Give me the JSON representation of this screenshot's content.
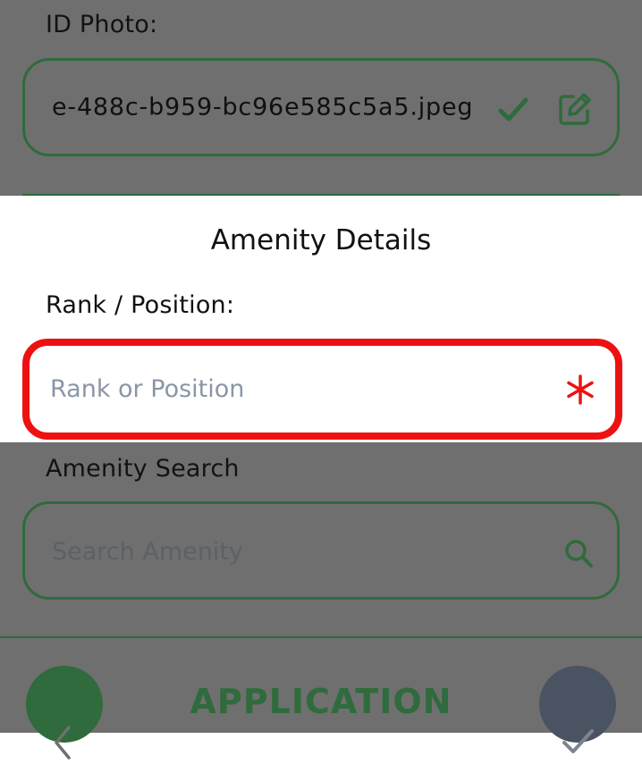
{
  "id_photo": {
    "label": "ID Photo:",
    "value": "e-488c-b959-bc96e585c5a5.jpeg"
  },
  "amenity_details": {
    "title": "Amenity Details"
  },
  "rank_position": {
    "label": "Rank / Position:",
    "placeholder": "Rank or Position",
    "required_marker_icon": "asterisk-icon"
  },
  "amenity_search": {
    "label": "Amenity Search",
    "placeholder": "Search Amenity",
    "icon": "search-icon"
  },
  "footer": {
    "title": "APPLICATION",
    "back_icon": "chevron-left-icon",
    "submit_icon": "check-icon"
  },
  "colors": {
    "accent": "#2F6B3C",
    "highlight_border": "#EE1111",
    "overlay": "#6F6F6F",
    "secondary_button": "#4A5361"
  }
}
